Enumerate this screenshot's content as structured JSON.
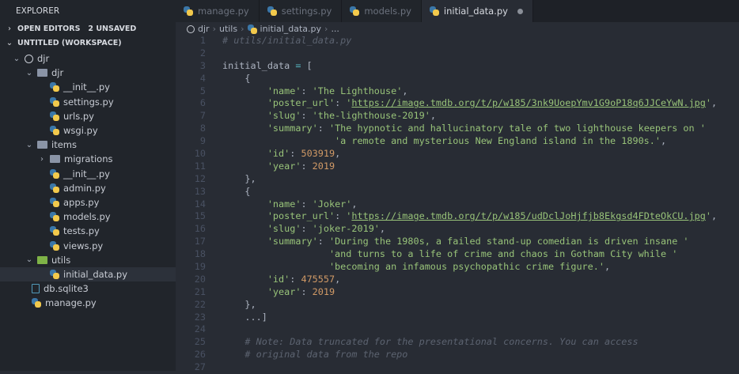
{
  "sidebar": {
    "title": "EXPLORER",
    "open_editors": "OPEN EDITORS",
    "unsaved": "2 UNSAVED",
    "workspace": "UNTITLED (WORKSPACE)",
    "tree": [
      {
        "label": "djr",
        "indent": 0,
        "icon": "circle",
        "chev": "v"
      },
      {
        "label": "djr",
        "indent": 1,
        "icon": "folder",
        "chev": "v"
      },
      {
        "label": "__init__.py",
        "indent": 2,
        "icon": "python"
      },
      {
        "label": "settings.py",
        "indent": 2,
        "icon": "python"
      },
      {
        "label": "urls.py",
        "indent": 2,
        "icon": "python"
      },
      {
        "label": "wsgi.py",
        "indent": 2,
        "icon": "python"
      },
      {
        "label": "items",
        "indent": 1,
        "icon": "folder",
        "chev": "v"
      },
      {
        "label": "migrations",
        "indent": 2,
        "icon": "folder",
        "chev": ">"
      },
      {
        "label": "__init__.py",
        "indent": 2,
        "icon": "python"
      },
      {
        "label": "admin.py",
        "indent": 2,
        "icon": "python"
      },
      {
        "label": "apps.py",
        "indent": 2,
        "icon": "python"
      },
      {
        "label": "models.py",
        "indent": 2,
        "icon": "python"
      },
      {
        "label": "tests.py",
        "indent": 2,
        "icon": "python"
      },
      {
        "label": "views.py",
        "indent": 2,
        "icon": "python"
      },
      {
        "label": "utils",
        "indent": 1,
        "icon": "folder-green",
        "chev": "v"
      },
      {
        "label": "initial_data.py",
        "indent": 2,
        "icon": "python",
        "selected": true
      },
      {
        "label": "db.sqlite3",
        "indent": 1.5,
        "icon": "file"
      },
      {
        "label": "manage.py",
        "indent": 1.5,
        "icon": "python"
      }
    ]
  },
  "tabs": [
    {
      "label": "manage.py"
    },
    {
      "label": "settings.py"
    },
    {
      "label": "models.py"
    },
    {
      "label": "initial_data.py",
      "active": true,
      "unsaved": true
    }
  ],
  "breadcrumb": [
    "djr",
    "utils",
    "initial_data.py",
    "..."
  ],
  "code": [
    [
      [
        "c",
        "# utils/initial_data.py"
      ]
    ],
    [],
    [
      [
        "p",
        "initial_data "
      ],
      [
        "o",
        "="
      ],
      [
        "p",
        " ["
      ]
    ],
    [
      [
        "p",
        "    {"
      ]
    ],
    [
      [
        "p",
        "        "
      ],
      [
        "s",
        "'name'"
      ],
      [
        "p",
        ": "
      ],
      [
        "s",
        "'The Lighthouse'"
      ],
      [
        "p",
        ","
      ]
    ],
    [
      [
        "p",
        "        "
      ],
      [
        "s",
        "'poster_url'"
      ],
      [
        "p",
        ": "
      ],
      [
        "s",
        "'"
      ],
      [
        "u",
        "https://image.tmdb.org/t/p/w185/3nk9UoepYmv1G9oP18q6JJCeYwN.jpg"
      ],
      [
        "s",
        "'"
      ],
      [
        "p",
        ","
      ]
    ],
    [
      [
        "p",
        "        "
      ],
      [
        "s",
        "'slug'"
      ],
      [
        "p",
        ": "
      ],
      [
        "s",
        "'the-lighthouse-2019'"
      ],
      [
        "p",
        ","
      ]
    ],
    [
      [
        "p",
        "        "
      ],
      [
        "s",
        "'summary'"
      ],
      [
        "p",
        ": "
      ],
      [
        "s",
        "'The hypnotic and hallucinatory tale of two lighthouse keepers on '"
      ]
    ],
    [
      [
        "p",
        "                    "
      ],
      [
        "s",
        "'a remote and mysterious New England island in the 1890s.'"
      ],
      [
        "p",
        ","
      ]
    ],
    [
      [
        "p",
        "        "
      ],
      [
        "s",
        "'id'"
      ],
      [
        "p",
        ": "
      ],
      [
        "n",
        "503919"
      ],
      [
        "p",
        ","
      ]
    ],
    [
      [
        "p",
        "        "
      ],
      [
        "s",
        "'year'"
      ],
      [
        "p",
        ": "
      ],
      [
        "n",
        "2019"
      ]
    ],
    [
      [
        "p",
        "    },"
      ]
    ],
    [
      [
        "p",
        "    {"
      ]
    ],
    [
      [
        "p",
        "        "
      ],
      [
        "s",
        "'name'"
      ],
      [
        "p",
        ": "
      ],
      [
        "s",
        "'Joker'"
      ],
      [
        "p",
        ","
      ]
    ],
    [
      [
        "p",
        "        "
      ],
      [
        "s",
        "'poster_url'"
      ],
      [
        "p",
        ": "
      ],
      [
        "s",
        "'"
      ],
      [
        "u",
        "https://image.tmdb.org/t/p/w185/udDclJoHjfjb8Ekgsd4FDteOkCU.jpg"
      ],
      [
        "s",
        "'"
      ],
      [
        "p",
        ","
      ]
    ],
    [
      [
        "p",
        "        "
      ],
      [
        "s",
        "'slug'"
      ],
      [
        "p",
        ": "
      ],
      [
        "s",
        "'joker-2019'"
      ],
      [
        "p",
        ","
      ]
    ],
    [
      [
        "p",
        "        "
      ],
      [
        "s",
        "'summary'"
      ],
      [
        "p",
        ": "
      ],
      [
        "s",
        "'During the 1980s, a failed stand-up comedian is driven insane '"
      ]
    ],
    [
      [
        "p",
        "                   "
      ],
      [
        "s",
        "'and turns to a life of crime and chaos in Gotham City while '"
      ]
    ],
    [
      [
        "p",
        "                   "
      ],
      [
        "s",
        "'becoming an infamous psychopathic crime figure.'"
      ],
      [
        "p",
        ","
      ]
    ],
    [
      [
        "p",
        "        "
      ],
      [
        "s",
        "'id'"
      ],
      [
        "p",
        ": "
      ],
      [
        "n",
        "475557"
      ],
      [
        "p",
        ","
      ]
    ],
    [
      [
        "p",
        "        "
      ],
      [
        "s",
        "'year'"
      ],
      [
        "p",
        ": "
      ],
      [
        "n",
        "2019"
      ]
    ],
    [
      [
        "p",
        "    },"
      ]
    ],
    [
      [
        "p",
        "    ...]"
      ]
    ],
    [],
    [
      [
        "p",
        "    "
      ],
      [
        "c",
        "# Note: Data truncated for the presentational concerns. You can access"
      ]
    ],
    [
      [
        "p",
        "    "
      ],
      [
        "c",
        "# original data from the repo"
      ]
    ],
    []
  ]
}
